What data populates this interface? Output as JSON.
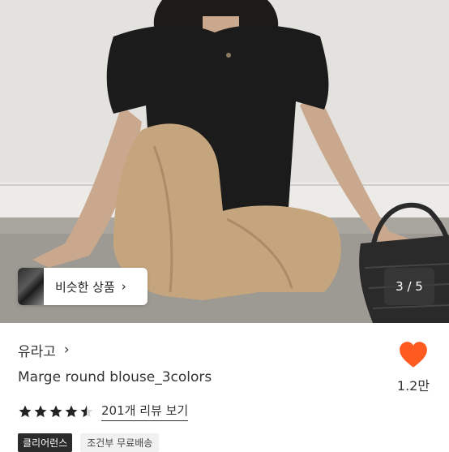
{
  "colors": {
    "heart": "#ff5a1f",
    "badge_dark": "#2b2b2b",
    "badge_light_bg": "#f1f1f1",
    "star": "#222222"
  },
  "hero": {
    "image_description_icon": "product-photo",
    "similar_button": {
      "label": "비슷한 상품",
      "chevron_icon": "chevron-right-icon"
    },
    "page_counter": "3 / 5"
  },
  "shop": {
    "name": "유라고",
    "chevron_icon": "chevron-right-icon"
  },
  "product": {
    "title": "Marge round blouse_3colors"
  },
  "rating": {
    "value": 4.5,
    "max": 5,
    "review_link": "201개 리뷰 보기"
  },
  "badges": {
    "primary": "클리어런스",
    "secondary": "조건부 무료배송"
  },
  "like": {
    "icon": "heart-icon",
    "count": "1.2만"
  }
}
